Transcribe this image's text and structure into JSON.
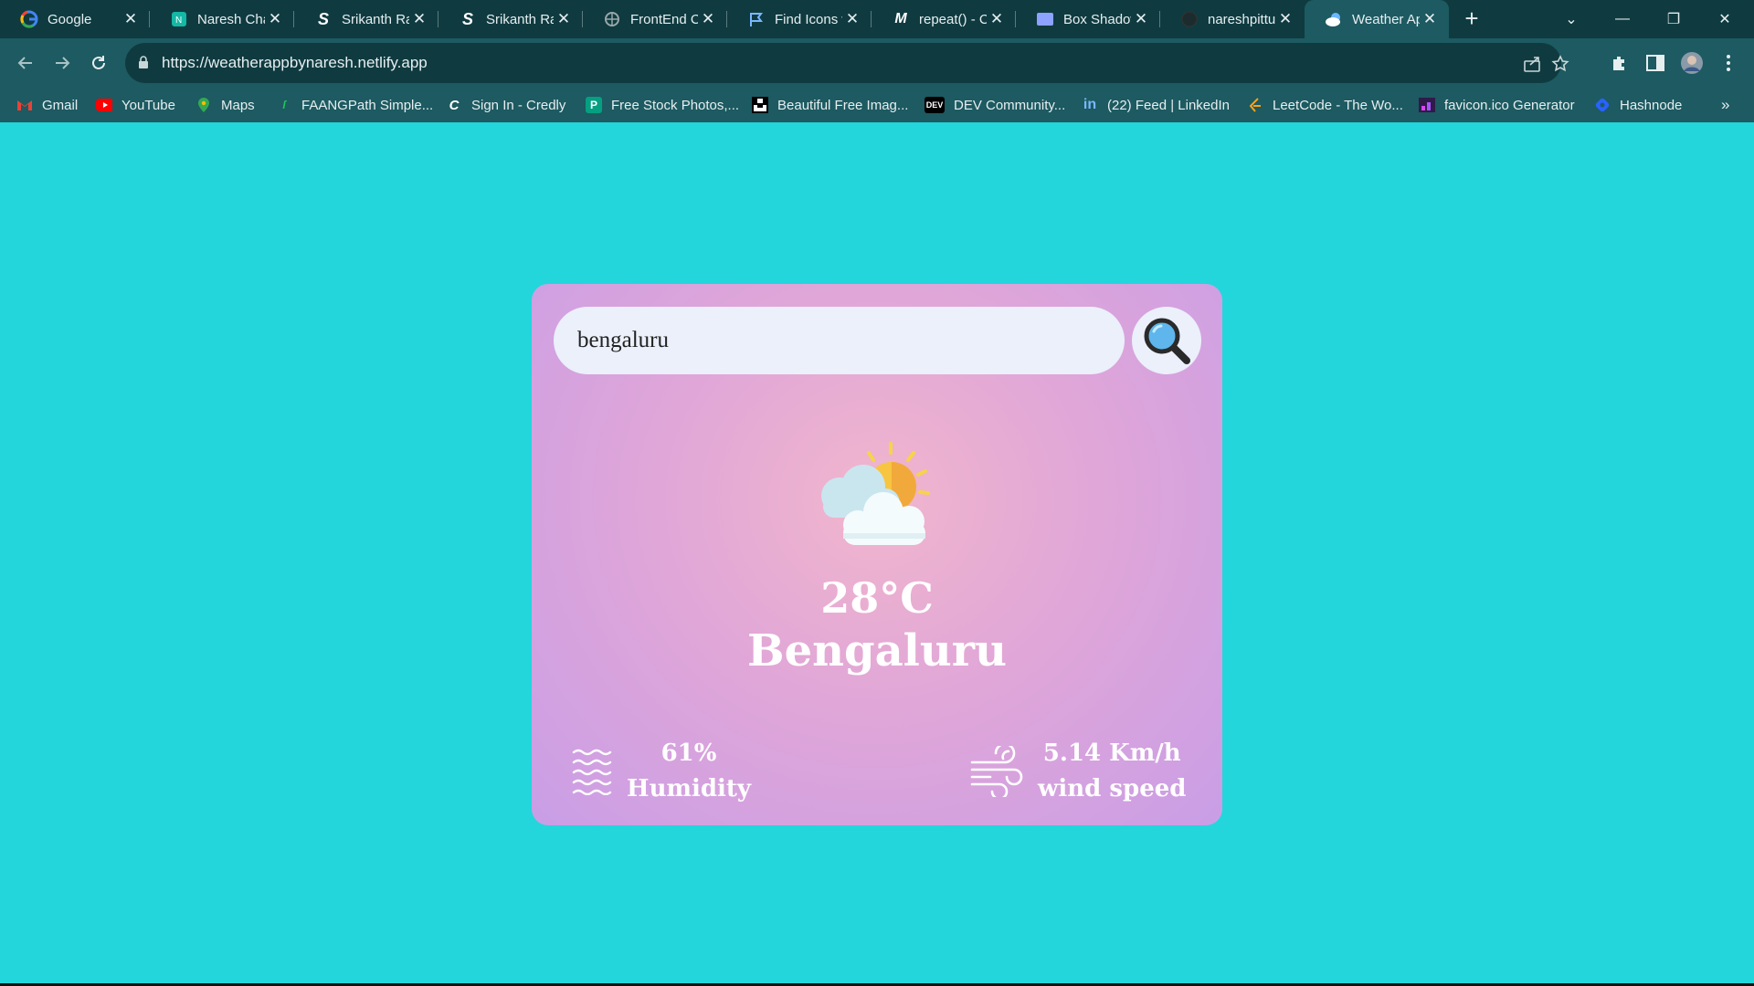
{
  "browser": {
    "tabs": [
      {
        "title": "Google",
        "icon": "google-icon",
        "color": "#4285f4"
      },
      {
        "title": "Naresh Chandra",
        "icon": "naresh-icon",
        "color": "#14b8a6"
      },
      {
        "title": "Srikanth Ravi",
        "icon": "s-logo-icon",
        "color": "#ffffff"
      },
      {
        "title": "Srikanth Ravi",
        "icon": "s-logo-icon",
        "color": "#ffffff"
      },
      {
        "title": "FrontEnd Code",
        "icon": "globe-icon",
        "color": "#9aa7aa"
      },
      {
        "title": "Find Icons with",
        "icon": "flag-icon",
        "color": "#7ab7ff"
      },
      {
        "title": "repeat() - CSS",
        "icon": "mdn-icon",
        "color": "#ffffff"
      },
      {
        "title": "Box Shadow",
        "icon": "box-icon",
        "color": "#8ea2ff"
      },
      {
        "title": "nareshpittu",
        "icon": "github-icon",
        "color": "#333333"
      },
      {
        "title": "Weather App",
        "icon": "weather-tab-icon",
        "color": "#6ab7ff"
      }
    ],
    "url": "https://weatherappbynaresh.netlify.app",
    "bookmarks": [
      {
        "label": "Gmail",
        "icon": "gmail-icon",
        "color": "#ea4335"
      },
      {
        "label": "YouTube",
        "icon": "youtube-icon",
        "color": "#ff0000"
      },
      {
        "label": "Maps",
        "icon": "maps-icon",
        "color": "#34a853"
      },
      {
        "label": "FAANGPath Simple...",
        "icon": "faangpath-icon",
        "color": "#22c55e"
      },
      {
        "label": "Sign In - Credly",
        "icon": "credly-icon",
        "color": "#1f2937"
      },
      {
        "label": "Free Stock Photos,...",
        "icon": "pexels-icon",
        "color": "#05a081"
      },
      {
        "label": "Beautiful Free Imag...",
        "icon": "unsplash-icon",
        "color": "#000000"
      },
      {
        "label": "DEV Community...",
        "icon": "dev-icon",
        "color": "#000000"
      },
      {
        "label": "(22) Feed | LinkedIn",
        "icon": "linkedin-icon",
        "color": "#0a66c2"
      },
      {
        "label": "LeetCode - The Wo...",
        "icon": "leetcode-icon",
        "color": "#ffa116"
      },
      {
        "label": "favicon.ico Generator",
        "icon": "favicon-icon",
        "color": "#d946ef"
      },
      {
        "label": "Hashnode",
        "icon": "hashnode-icon",
        "color": "#2962ff"
      }
    ]
  },
  "app": {
    "search_value": "bengaluru",
    "temperature": "28°C",
    "city": "Bengaluru",
    "humidity_value": "61%",
    "humidity_label": "Humidity",
    "wind_value": "5.14 Km/h",
    "wind_label": "wind speed",
    "colors": {
      "page_bg": "#22d6dc",
      "card_gradient_center": "#f1b6cc",
      "card_gradient_edge": "#c99ee6",
      "input_bg": "#ebf0fb"
    }
  }
}
